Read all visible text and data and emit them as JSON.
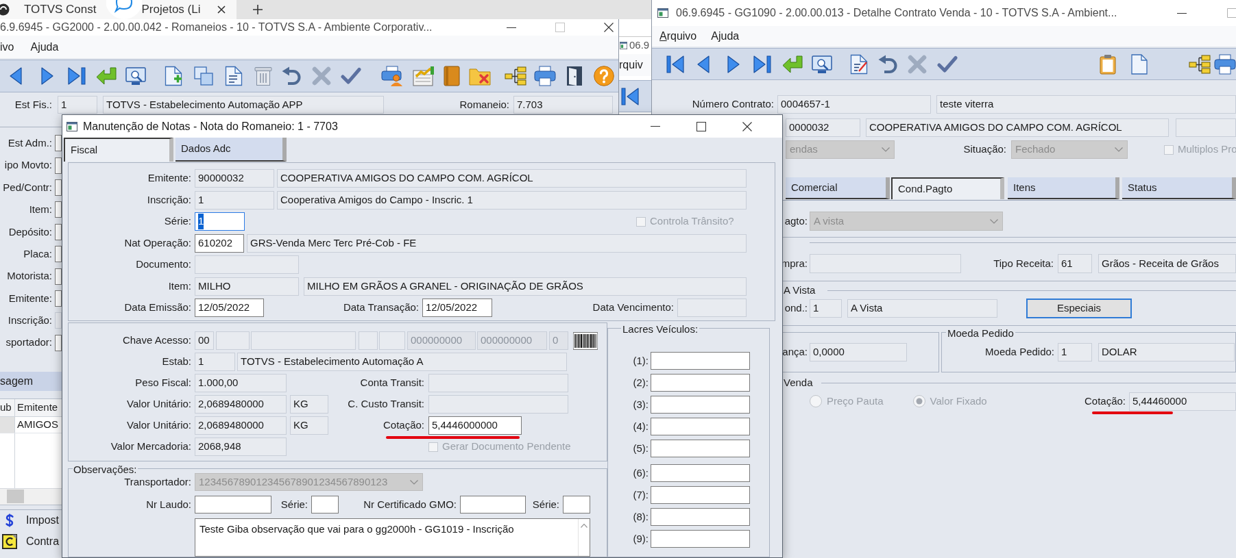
{
  "browser_tab": {
    "title_start": "TOTVS Const",
    "title_end": "Projetos (Li"
  },
  "romaneios_window": {
    "title": "6.9.6945 - GG2000 - 2.00.00.042 - Romaneios - 10 - TOTVS S.A - Ambiente Corporativ...",
    "menu": [
      "ivo",
      "Ajuda"
    ],
    "header": [
      {
        "label": "Est Fis.:",
        "fields": [
          {
            "value": "1",
            "kind": "readonly"
          },
          {
            "value": "TOTVS - Estabelecimento Automação APP",
            "kind": "readonly"
          }
        ]
      },
      {
        "label": "Romaneio:",
        "fields": [
          {
            "value": "7.703",
            "kind": "readonly"
          }
        ]
      }
    ],
    "form": [
      {
        "label": "Est Adm.:",
        "field": {
          "kind": "input"
        }
      },
      {
        "label": "ipo Movto:",
        "field": {
          "kind": "input"
        }
      },
      {
        "label": "Ped/Contr:",
        "field": {
          "kind": "input"
        }
      },
      {
        "label": "Item:",
        "field": {
          "kind": "input"
        }
      },
      {
        "label": "Depósito:",
        "field": {
          "kind": "input"
        }
      },
      {
        "label": "Placa:",
        "field": {
          "kind": "input"
        }
      },
      {
        "label": "Motorista:",
        "field": {
          "kind": "input"
        }
      },
      {
        "label": "Emitente:",
        "field": {
          "kind": "input"
        }
      },
      {
        "label": "Inscrição:",
        "field": {
          "kind": "readonly"
        }
      },
      {
        "label": "sportador:",
        "field": {
          "kind": "input"
        }
      }
    ],
    "grid": {
      "title": "sagem",
      "columns": [
        "ub",
        "Emitente"
      ],
      "rows": [
        [
          null,
          "AMIGOS"
        ]
      ]
    },
    "actions": [
      "Impost",
      "Contra"
    ]
  },
  "middle_window": {
    "title": "06.9",
    "menu": [
      "rquiv"
    ]
  },
  "contrato_window": {
    "title": "06.9.6945 - GG1090 - 2.00.00.013 - Detalhe Contrato Venda - 10 - TOTVS S.A - Ambient...",
    "menu": [
      {
        "key": "A",
        "after": "rquivo"
      },
      {
        "before": "A",
        "key": "j",
        "after": "uda"
      }
    ],
    "contract_row": {
      "label": "Número Contrato:",
      "fields": [
        {
          "value": "0004657-1",
          "kind": "readonly"
        },
        {
          "value": "teste viterra",
          "kind": "readonly"
        }
      ]
    },
    "client_row": {
      "fields": [
        {
          "value": "0000032",
          "kind": "readonly"
        },
        {
          "value": "COOPERATIVA AMIGOS DO CAMPO COM. AGRÍCOL",
          "kind": "readonly"
        },
        {
          "kind": "readonly"
        }
      ]
    },
    "status_row": {
      "type_select": {
        "value": "endas",
        "disabled": true
      },
      "situation": {
        "label": "Situação:",
        "select": {
          "value": "Fechado",
          "disabled": true
        }
      },
      "multiple": {
        "label": "Multiplos Pro",
        "checked": false,
        "disabled": true
      }
    },
    "tabs": [
      {
        "label": "Comercial",
        "selected": false
      },
      {
        "label": "Cond.Pagto",
        "selected": true
      },
      {
        "label": "Itens",
        "selected": false
      },
      {
        "label": "Status",
        "selected": false
      }
    ],
    "payment_tab": {
      "condition": {
        "label": "agto:",
        "select": {
          "value": "A vista",
          "disabled": true
        }
      },
      "purchase": {
        "label": "mpra:",
        "field": {
          "kind": "readonly"
        }
      },
      "revenue_type": {
        "label": "Tipo Receita:",
        "fields": [
          {
            "value": "61",
            "kind": "readonly"
          },
          {
            "value": "Grãos - Receita de Grãos",
            "kind": "readonly"
          }
        ]
      },
      "cash_group": {
        "title": "A Vista",
        "label": "ond.:",
        "fields": [
          {
            "value": "1",
            "kind": "readonly"
          },
          {
            "value": "A Vista",
            "kind": "readonly"
          }
        ],
        "button": "Especiais"
      },
      "left_group": {
        "label": "ança:",
        "field": {
          "value": "0,0000",
          "kind": "readonly"
        }
      },
      "currency_group": {
        "title": "Moeda Pedido",
        "label": "Moeda Pedido:",
        "fields": [
          {
            "value": "1",
            "kind": "readonly"
          },
          {
            "value": "DOLAR",
            "kind": "readonly"
          }
        ]
      },
      "sale_group": {
        "title": "Venda",
        "radios": [
          {
            "label": "Preço Pauta",
            "selected": false,
            "disabled": true
          },
          {
            "label": "Valor Fixado",
            "selected": true,
            "disabled": true
          }
        ],
        "quote": {
          "label": "Cotação:",
          "field": {
            "value": "5,44460000",
            "kind": "readonly"
          },
          "highlighted": true
        }
      }
    }
  },
  "notas_dialog": {
    "title": "Manutenção de Notas - Nota do Romaneio: 1 - 7703",
    "tabs": [
      {
        "label": "Fiscal",
        "selected": true
      },
      {
        "label": "Dados Adc",
        "selected": false
      }
    ],
    "header_rows": [
      {
        "label": "Emitente:",
        "fields": [
          {
            "value": "90000032",
            "kind": "readonly"
          },
          {
            "value": "COOPERATIVA AMIGOS DO CAMPO COM. AGRÍCOL",
            "kind": "readonly"
          }
        ]
      },
      {
        "label": "Inscrição:",
        "fields": [
          {
            "value": "1",
            "kind": "readonly"
          },
          {
            "value": "Cooperativa Amigos do Campo - Inscric. 1",
            "kind": "readonly"
          }
        ]
      },
      {
        "label": "Série:",
        "fields": [
          {
            "value": "1",
            "kind": "focused"
          }
        ],
        "checkbox": {
          "label": "Controla Trânsito?",
          "checked": false,
          "disabled": true
        }
      },
      {
        "label": "Nat Operação:",
        "fields": [
          {
            "value": "610202",
            "kind": "input"
          },
          {
            "value": "GRS-Venda Merc Terc Pré-Cob - FE",
            "kind": "readonly"
          }
        ]
      },
      {
        "label": "Documento:",
        "fields": [
          {
            "kind": "readonly"
          }
        ]
      },
      {
        "label": "Item:",
        "fields": [
          {
            "value": "MILHO",
            "kind": "readonly"
          },
          {
            "value": "MILHO EM GRÃOS A GRANEL - ORIGINAÇÃO DE GRÃOS",
            "kind": "readonly"
          }
        ]
      }
    ],
    "dates": [
      {
        "label": "Data Emissão:",
        "field": {
          "value": "12/05/2022",
          "kind": "input"
        }
      },
      {
        "label": "Data Transação:",
        "field": {
          "value": "12/05/2022",
          "kind": "input"
        }
      },
      {
        "label": "Data Vencimento:",
        "field": {
          "kind": "readonly"
        }
      }
    ],
    "fiscal_rows": [
      {
        "label": "Chave Acesso:",
        "fields": [
          {
            "value": "00",
            "kind": "readonly"
          },
          {
            "kind": "readonly"
          },
          {
            "kind": "readonly"
          },
          {
            "kind": "readonly"
          },
          {
            "kind": "readonly"
          },
          {
            "value": "000000000",
            "kind": "disabled"
          },
          {
            "value": "000000000",
            "kind": "disabled"
          },
          {
            "value": "0",
            "kind": "disabled"
          }
        ]
      },
      {
        "label": "Estab:",
        "fields": [
          {
            "value": "1",
            "kind": "readonly"
          },
          {
            "value": "TOTVS - Estabelecimento Automação A",
            "kind": "readonly"
          }
        ]
      },
      {
        "label": "Peso Fiscal:",
        "fields": [
          {
            "value": "1.000,00",
            "kind": "readonly"
          }
        ],
        "right": {
          "label": "Conta Transit:",
          "field": {
            "kind": "readonly"
          }
        }
      },
      {
        "label": "Valor Unitário:",
        "fields": [
          {
            "value": "2,0689480000",
            "kind": "readonly"
          },
          {
            "value": "KG",
            "kind": "readonly"
          }
        ],
        "right": {
          "label": "C. Custo Transit:",
          "field": {
            "kind": "readonly"
          }
        }
      },
      {
        "label": "Valor Unitário:",
        "fields": [
          {
            "value": "2,0689480000",
            "kind": "readonly"
          },
          {
            "value": "KG",
            "kind": "readonly"
          }
        ],
        "right": {
          "label": "Cotação:",
          "field": {
            "value": "5,4446000000",
            "kind": "input"
          },
          "highlighted": true
        }
      },
      {
        "label": "Valor Mercadoria:",
        "fields": [
          {
            "value": "2068,948",
            "kind": "readonly"
          }
        ],
        "checkbox": {
          "label": "Gerar Documento Pendente",
          "checked": false,
          "disabled": true
        }
      }
    ],
    "observations": {
      "title": "Observações:",
      "carrier": {
        "label": "Transportador:",
        "select": {
          "value": "123456789012345678901234567890123",
          "disabled": true
        }
      },
      "lab_fields": [
        {
          "label": "Nr Laudo:",
          "field": {
            "kind": "input"
          }
        },
        {
          "label": "Série:",
          "field": {
            "kind": "input"
          }
        },
        {
          "label": "Nr Certificado GMO:",
          "field": {
            "kind": "input"
          }
        },
        {
          "label": "Série:",
          "field": {
            "kind": "input"
          }
        }
      ],
      "notes": "Teste Giba observação que vai para o gg2000h - GG1019 - Inscrição"
    },
    "seals": {
      "title": "Lacres Veículos:",
      "items": [
        {
          "label": "(1):",
          "field": {
            "kind": "input"
          }
        },
        {
          "label": "(2):",
          "field": {
            "kind": "input"
          }
        },
        {
          "label": "(3):",
          "field": {
            "kind": "input"
          }
        },
        {
          "label": "(4):",
          "field": {
            "kind": "input"
          }
        },
        {
          "label": "(5):",
          "field": {
            "kind": "input"
          }
        },
        {
          "label": "(6):",
          "field": {
            "kind": "input"
          }
        },
        {
          "label": "(7):",
          "field": {
            "kind": "input"
          }
        },
        {
          "label": "(8):",
          "field": {
            "kind": "input"
          }
        },
        {
          "label": "(9):",
          "field": {
            "kind": "input"
          }
        }
      ]
    }
  }
}
